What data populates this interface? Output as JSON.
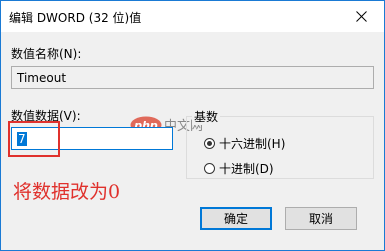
{
  "window": {
    "title": "编辑 DWORD (32 位)值"
  },
  "value_name": {
    "label": "数值名称(N):",
    "value": "Timeout"
  },
  "value_data": {
    "label": "数值数据(V):",
    "value": "7"
  },
  "base": {
    "label": "基数",
    "options": [
      {
        "label": "十六进制(H)",
        "checked": true
      },
      {
        "label": "十进制(D)",
        "checked": false
      }
    ]
  },
  "annotation": "将数据改为0",
  "watermark": {
    "logo_text": "php",
    "site_text": "中文网"
  },
  "buttons": {
    "ok": "确定",
    "cancel": "取消"
  },
  "icons": {
    "close": "close-icon",
    "radio": "radio-icon"
  },
  "colors": {
    "accent": "#0078d7",
    "annotation_red": "#e0312c"
  }
}
